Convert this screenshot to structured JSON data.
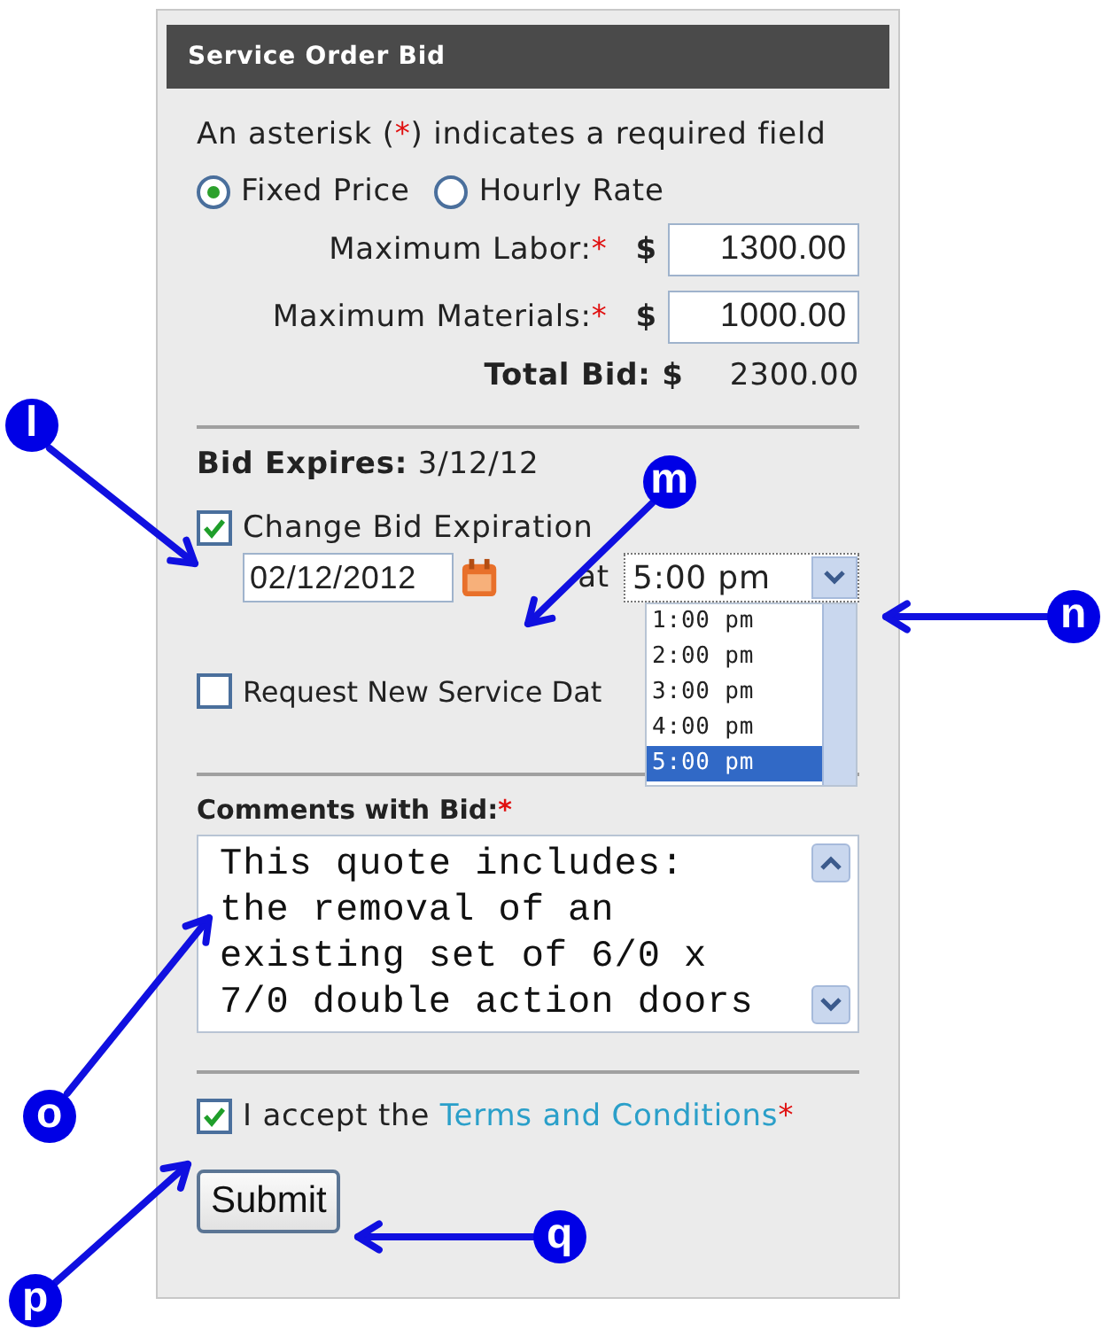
{
  "panel": {
    "title": "Service Order Bid"
  },
  "required_note": {
    "before": "An asterisk (",
    "mark": "*",
    "after": ") indicates a required field"
  },
  "pricing": [
    {
      "label": "Fixed Price",
      "selected": true
    },
    {
      "label": "Hourly Rate",
      "selected": false
    }
  ],
  "amounts": [
    {
      "label": "Maximum Labor:",
      "mark": "*",
      "currency": "$",
      "value": "1300.00"
    },
    {
      "label": "Maximum Materials:",
      "mark": "*",
      "currency": "$",
      "value": "1000.00"
    }
  ],
  "total": {
    "label": "Total Bid: $",
    "value": "2300.00"
  },
  "expires": {
    "label": "Bid Expires:",
    "value": "3/12/12"
  },
  "change_expiration": {
    "label": "Change Bid Expiration",
    "checked": true
  },
  "expiration_date": {
    "value": "02/12/2012"
  },
  "at_label": "at",
  "time_select": {
    "value": "5:00 pm",
    "expanded": true,
    "options": [
      {
        "label": "1:00 pm",
        "selected": false
      },
      {
        "label": "2:00 pm",
        "selected": false
      },
      {
        "label": "3:00 pm",
        "selected": false
      },
      {
        "label": "4:00 pm",
        "selected": false
      },
      {
        "label": "5:00 pm",
        "selected": true
      }
    ]
  },
  "request_new_date": {
    "label": "Request New Service Dat",
    "checked": false
  },
  "comments": {
    "label": "Comments with Bid:",
    "mark": "*",
    "value": "This quote includes:\nthe removal of an\nexisting set of 6/0 x\n7/0 double action doors"
  },
  "terms": {
    "checked": true,
    "before": "I accept the ",
    "link": "Terms and Conditions",
    "mark": "*"
  },
  "submit": "Submit",
  "callouts": [
    {
      "letter": "l"
    },
    {
      "letter": "m"
    },
    {
      "letter": "n"
    },
    {
      "letter": "o"
    },
    {
      "letter": "p"
    },
    {
      "letter": "q"
    }
  ]
}
